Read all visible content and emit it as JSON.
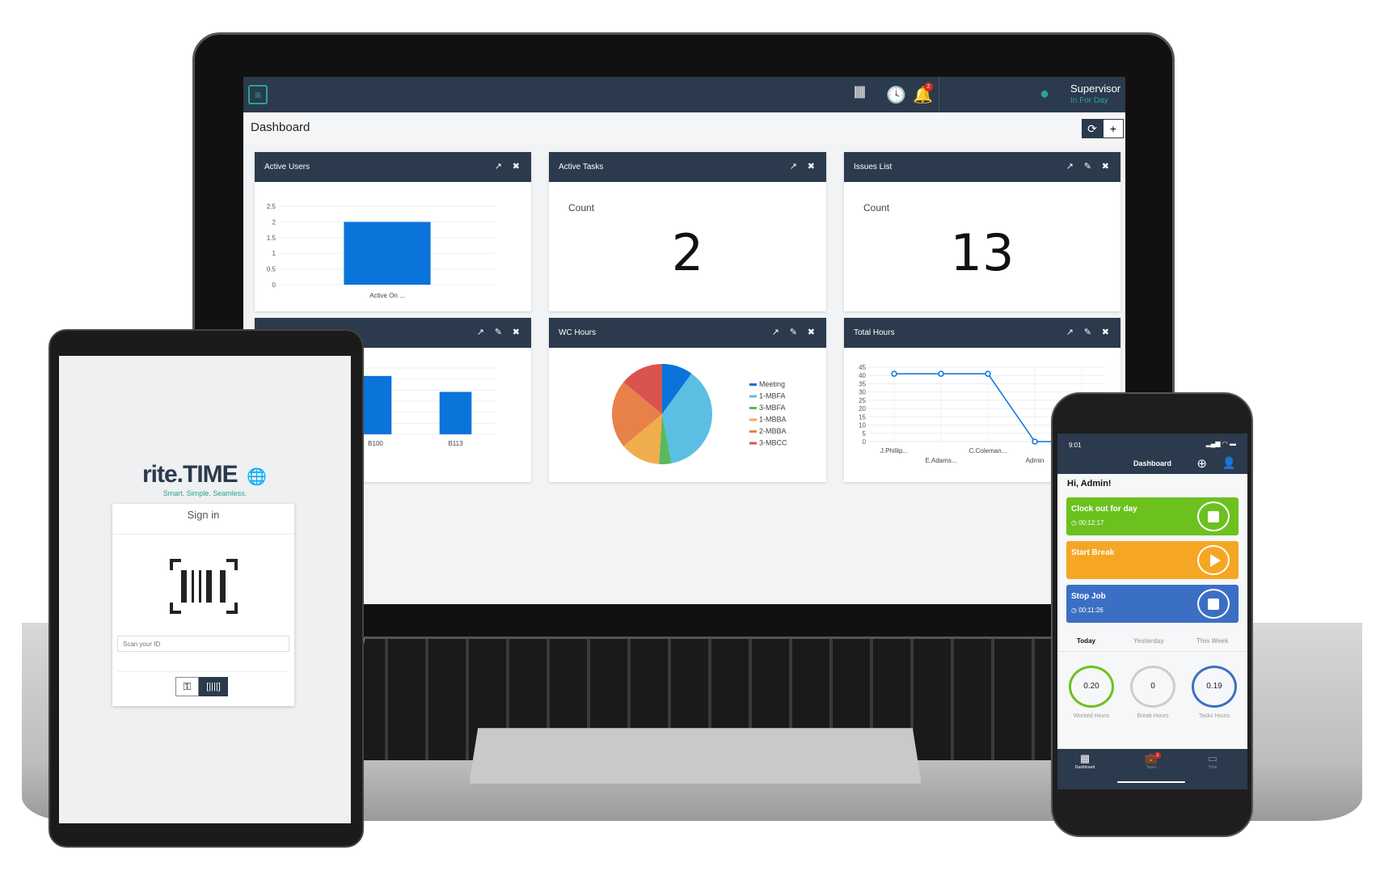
{
  "app": {
    "topbar": {
      "user_name": "Supervisor",
      "user_status": "In For Day",
      "notification_count": "2"
    },
    "page_title": "Dashboard",
    "refresh_label": "⟳",
    "add_label": "+"
  },
  "cards": [
    {
      "title": "Active Users"
    },
    {
      "title": "Active Tasks",
      "count_label": "Count",
      "count_value": "2"
    },
    {
      "title": "Issues List",
      "count_label": "Count",
      "count_value": "13"
    },
    {
      "title": ""
    },
    {
      "title": "WC Hours"
    },
    {
      "title": "Total Hours"
    }
  ],
  "chart_data": [
    {
      "type": "bar",
      "title": "Active Users",
      "categories": [
        "Active On ..."
      ],
      "values": [
        2
      ],
      "ylim": [
        0,
        2.5
      ],
      "yticks": [
        "0",
        "0.5",
        "1",
        "1.5",
        "2",
        "2.5"
      ],
      "color": "#0a74da",
      "grid": true
    },
    {
      "type": "bar",
      "categories": [
        "B100",
        "B113"
      ],
      "values": [
        2.2,
        1.6
      ],
      "color": "#0a74da",
      "grid": true
    },
    {
      "type": "pie",
      "title": "WC Hours",
      "legend": "right",
      "slices": [
        {
          "name": "Meeting",
          "value": 10,
          "color": "#0a74da"
        },
        {
          "name": "1-MBFA",
          "value": 37,
          "color": "#5bbfe3"
        },
        {
          "name": "3-MBFA",
          "value": 4,
          "color": "#5cb85c"
        },
        {
          "name": "1-MBBA",
          "value": 13,
          "color": "#f0ad4e"
        },
        {
          "name": "2-MBBA",
          "value": 22,
          "color": "#e8804a"
        },
        {
          "name": "3-MBCC",
          "value": 14,
          "color": "#d9534f"
        }
      ]
    },
    {
      "type": "line",
      "title": "Total Hours",
      "categories": [
        "J.Phillip...",
        "E.Adams...",
        "C.Coleman...",
        "Admin",
        ""
      ],
      "values": [
        41,
        41,
        41,
        0,
        0
      ],
      "ylim": [
        0,
        45
      ],
      "yticks": [
        "0",
        "5",
        "10",
        "15",
        "20",
        "25",
        "30",
        "35",
        "40",
        "45"
      ],
      "color": "#0a74da",
      "grid": true
    }
  ],
  "tablet": {
    "logo": "rite.TIME",
    "tagline": "Smart. Simple. Seamless.",
    "signin_title": "Sign in",
    "id_placeholder": "Scan your ID"
  },
  "phone": {
    "time": "9:01",
    "title": "Dashboard",
    "greeting": "Hi, Admin!",
    "actions": [
      {
        "label": "Clock out for day",
        "timer": "00:12:17",
        "color": "#6cc11f"
      },
      {
        "label": "Start Break",
        "timer": "",
        "color": "#f5a623"
      },
      {
        "label": "Stop Job",
        "timer": "00:11:26",
        "color": "#3b6fc4"
      }
    ],
    "tabs": [
      "Today",
      "Yesterday",
      "This Week"
    ],
    "stats": [
      {
        "value": "0.20",
        "label": "Worked Hours",
        "color": "#6cc11f"
      },
      {
        "value": "0",
        "label": "Break Hours",
        "color": "#ccc"
      },
      {
        "value": "0.19",
        "label": "Tasks Hours",
        "color": "#3b6fc4"
      }
    ],
    "nav": [
      {
        "label": "Dashboard"
      },
      {
        "label": "Tasks",
        "badge": "1"
      },
      {
        "label": "Time"
      }
    ]
  }
}
